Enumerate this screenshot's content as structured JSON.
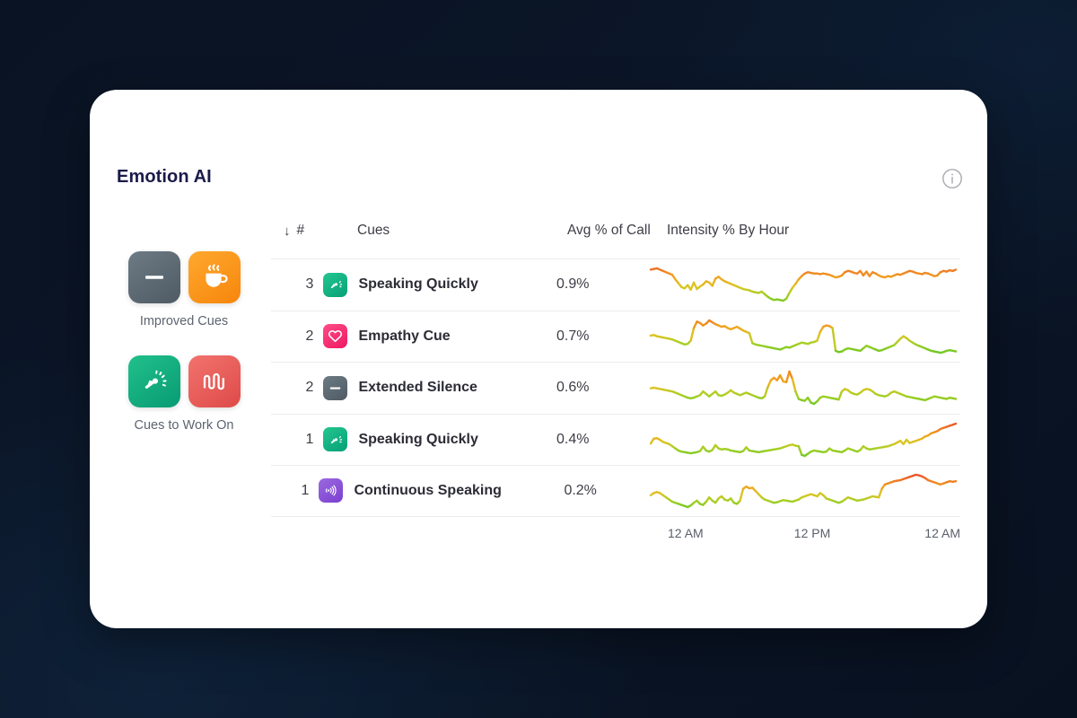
{
  "background": {
    "color_start": "#0a1323",
    "color_end": "#081120"
  },
  "card": {
    "title": "Emotion AI",
    "title_color": "#1b1b4b",
    "info_icon": "info-circle-icon"
  },
  "sidebar": {
    "groups": [
      {
        "label": "Improved Cues",
        "tiles": [
          {
            "icon": "extended-silence-icon",
            "color": "#4e5a64"
          },
          {
            "icon": "coffee-cup-icon",
            "color": "#f7860c"
          }
        ]
      },
      {
        "label": "Cues to Work On",
        "tiles": [
          {
            "icon": "speedometer-icon",
            "color": "#089b74"
          },
          {
            "icon": "waveform-icon",
            "color": "#de4a48"
          }
        ]
      }
    ]
  },
  "table": {
    "sort_indicator": "↓",
    "headers": {
      "rank": "#",
      "cue": "Cues",
      "avg": "Avg % of Call",
      "intensity": "Intensity % By Hour"
    },
    "rows": [
      {
        "rank": "3",
        "icon": "speedometer-icon",
        "name": "Speaking Quickly",
        "avg": "0.9%"
      },
      {
        "rank": "2",
        "icon": "heart-icon",
        "name": "Empathy Cue",
        "avg": "0.7%"
      },
      {
        "rank": "2",
        "icon": "minus-icon",
        "name": "Extended Silence",
        "avg": "0.6%"
      },
      {
        "rank": "1",
        "icon": "speedometer-icon",
        "name": "Speaking Quickly",
        "avg": "0.4%"
      },
      {
        "rank": "1",
        "icon": "sound-waves-icon",
        "name": "Continuous Speaking",
        "avg": "0.2%"
      }
    ],
    "axis_labels": [
      "12 AM",
      "12 PM",
      "12 AM"
    ]
  },
  "chart_data": {
    "type": "line",
    "title": "Intensity % By Hour",
    "xlabel": "",
    "ylabel": "Intensity %",
    "x_tick_labels": [
      "12 AM",
      "12 PM",
      "12 AM"
    ],
    "grid": false,
    "legend": "none",
    "colorscale": {
      "description": "line color encodes intensity: green = low, yellow = mid, orange/red = high",
      "low": "#6ecb2a",
      "mid": "#e8c720",
      "high": "#e8492f"
    },
    "ylim": [
      0,
      100
    ],
    "series": [
      {
        "name": "Speaking Quickly",
        "values": [
          72,
          73,
          74,
          72,
          70,
          68,
          66,
          64,
          57,
          51,
          45,
          43,
          48,
          41,
          52,
          42,
          46,
          49,
          54,
          52,
          47,
          58,
          61,
          57,
          54,
          52,
          50,
          48,
          46,
          44,
          42,
          41,
          40,
          38,
          37,
          36,
          38,
          34,
          30,
          27,
          25,
          26,
          25,
          24,
          27,
          36,
          44,
          50,
          57,
          62,
          66,
          68,
          67,
          66,
          66,
          65,
          66,
          65,
          64,
          62,
          60,
          61,
          63,
          68,
          70,
          69,
          67,
          66,
          70,
          63,
          69,
          62,
          68,
          66,
          63,
          61,
          60,
          62,
          61,
          63,
          65,
          64,
          66,
          68,
          70,
          69,
          67,
          66,
          65,
          67,
          66,
          64,
          62,
          63,
          68,
          70,
          69,
          71,
          70,
          72
        ]
      },
      {
        "name": "Empathy Cue",
        "values": [
          46,
          47,
          45,
          44,
          43,
          42,
          41,
          40,
          38,
          36,
          34,
          32,
          33,
          38,
          58,
          68,
          66,
          62,
          65,
          70,
          67,
          64,
          62,
          60,
          61,
          58,
          56,
          58,
          60,
          57,
          54,
          52,
          50,
          34,
          32,
          31,
          30,
          29,
          28,
          27,
          26,
          25,
          24,
          26,
          28,
          27,
          29,
          31,
          33,
          35,
          34,
          33,
          35,
          36,
          38,
          52,
          60,
          62,
          61,
          58,
          22,
          20,
          21,
          24,
          26,
          25,
          24,
          23,
          22,
          26,
          30,
          28,
          26,
          24,
          22,
          23,
          25,
          27,
          29,
          31,
          36,
          41,
          45,
          42,
          38,
          35,
          32,
          30,
          28,
          26,
          24,
          22,
          21,
          20,
          19,
          20,
          22,
          23,
          22,
          21
        ]
      },
      {
        "name": "Extended Silence",
        "values": [
          45,
          46,
          45,
          44,
          43,
          42,
          41,
          40,
          38,
          36,
          34,
          32,
          30,
          29,
          30,
          32,
          34,
          40,
          36,
          32,
          36,
          40,
          34,
          33,
          35,
          38,
          42,
          38,
          36,
          34,
          36,
          38,
          36,
          34,
          32,
          30,
          29,
          32,
          47,
          58,
          62,
          58,
          66,
          56,
          55,
          72,
          60,
          40,
          28,
          26,
          25,
          30,
          22,
          20,
          24,
          30,
          32,
          31,
          30,
          29,
          28,
          27,
          40,
          44,
          42,
          38,
          36,
          35,
          38,
          42,
          44,
          43,
          40,
          36,
          34,
          33,
          32,
          34,
          38,
          40,
          38,
          36,
          34,
          32,
          31,
          30,
          29,
          28,
          27,
          26,
          28,
          30,
          32,
          31,
          30,
          29,
          28,
          30,
          29,
          28
        ]
      },
      {
        "name": "Speaking Quickly",
        "values": [
          43,
          52,
          53,
          50,
          46,
          44,
          42,
          38,
          34,
          30,
          28,
          27,
          26,
          25,
          26,
          27,
          29,
          37,
          30,
          28,
          31,
          40,
          34,
          32,
          33,
          32,
          30,
          29,
          28,
          27,
          29,
          36,
          30,
          29,
          28,
          27,
          28,
          29,
          30,
          31,
          32,
          33,
          34,
          36,
          38,
          40,
          41,
          39,
          38,
          22,
          20,
          24,
          28,
          30,
          29,
          28,
          27,
          28,
          34,
          30,
          29,
          28,
          27,
          30,
          34,
          32,
          30,
          28,
          31,
          38,
          34,
          32,
          33,
          34,
          35,
          36,
          37,
          38,
          40,
          42,
          45,
          48,
          42,
          50,
          44,
          46,
          48,
          50,
          52,
          56,
          58,
          62,
          64,
          66,
          70,
          72,
          74,
          76,
          78,
          80
        ]
      },
      {
        "name": "Continuous Speaking",
        "values": [
          44,
          48,
          50,
          48,
          44,
          40,
          36,
          32,
          30,
          28,
          26,
          24,
          22,
          25,
          30,
          34,
          28,
          26,
          32,
          40,
          34,
          30,
          38,
          42,
          36,
          34,
          38,
          30,
          28,
          34,
          56,
          60,
          57,
          58,
          52,
          46,
          40,
          36,
          34,
          32,
          30,
          31,
          33,
          35,
          34,
          33,
          32,
          34,
          36,
          40,
          42,
          44,
          46,
          44,
          42,
          48,
          44,
          38,
          36,
          34,
          32,
          30,
          32,
          36,
          40,
          38,
          36,
          34,
          35,
          36,
          38,
          40,
          42,
          41,
          40,
          56,
          64,
          66,
          68,
          70,
          71,
          72,
          74,
          76,
          78,
          80,
          82,
          81,
          79,
          76,
          72,
          70,
          68,
          66,
          64,
          66,
          68,
          70,
          69,
          70
        ]
      }
    ]
  }
}
